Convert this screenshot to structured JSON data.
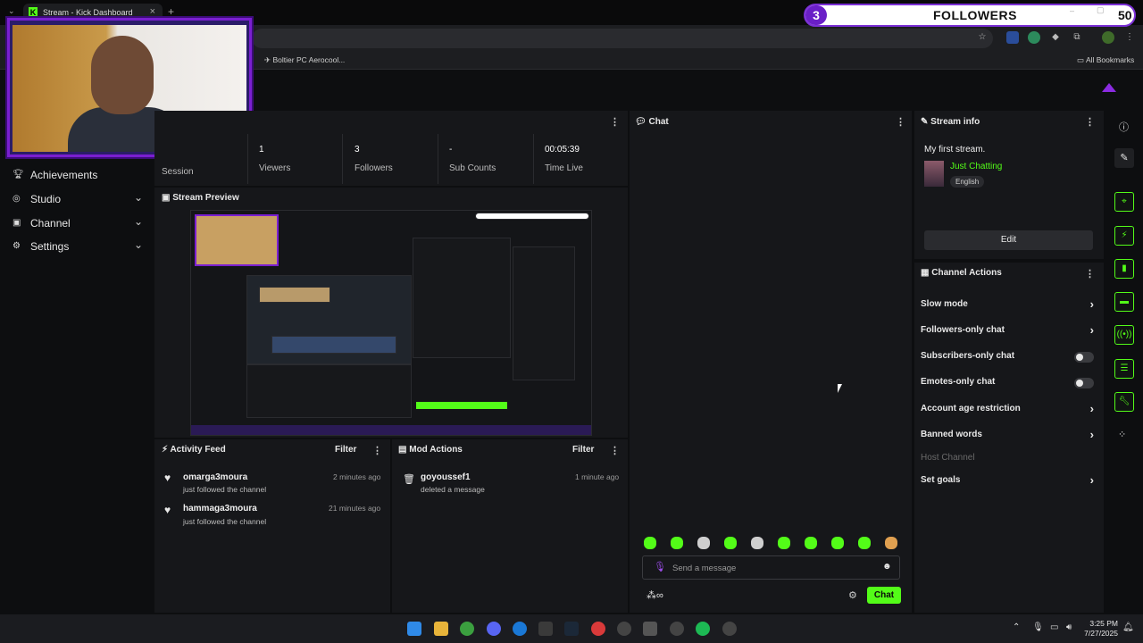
{
  "browser": {
    "tab_title": "Stream - Kick Dashboard",
    "bookmark": "Boltier PC Aerocool...",
    "all_bookmarks": "All Bookmarks"
  },
  "goal": {
    "current": "3",
    "label": "FOLLOWERS",
    "target": "50",
    "progress_fraction": 0.06,
    "accent": "#7b2fd6"
  },
  "sidebar": {
    "items": [
      {
        "label": "Achievements",
        "icon": "trophy-icon"
      },
      {
        "label": "Studio",
        "icon": "studio-icon"
      },
      {
        "label": "Channel",
        "icon": "channel-icon"
      },
      {
        "label": "Settings",
        "icon": "gear-icon"
      }
    ]
  },
  "stats": {
    "session_label": "Session",
    "items": [
      {
        "value": "1",
        "label": "Viewers"
      },
      {
        "value": "3",
        "label": "Followers"
      },
      {
        "value": "-",
        "label": "Sub Counts"
      },
      {
        "value": "00:05:39",
        "label": "Time Live"
      }
    ]
  },
  "preview": {
    "title": "Stream Preview"
  },
  "activity": {
    "title": "Activity Feed",
    "filter": "Filter",
    "items": [
      {
        "name": "omarga3moura",
        "action": "just followed the channel",
        "time": "2 minutes ago"
      },
      {
        "name": "hammaga3moura",
        "action": "just followed the channel",
        "time": "21 minutes ago"
      }
    ]
  },
  "mod_actions": {
    "title": "Mod Actions",
    "filter": "Filter",
    "items": [
      {
        "name": "goyoussef1",
        "action": "deleted a message",
        "time": "1 minute ago"
      }
    ]
  },
  "chat": {
    "title": "Chat",
    "placeholder": "Send a message",
    "send_label": "Chat",
    "accent": "#53fc18"
  },
  "stream_info": {
    "title": "Stream info",
    "stream_title": "My first stream.",
    "category": "Just Chatting",
    "language": "English",
    "edit_label": "Edit"
  },
  "channel_actions": {
    "title": "Channel Actions",
    "items": [
      {
        "label": "Slow mode",
        "control": "arrow"
      },
      {
        "label": "Followers-only chat",
        "control": "arrow"
      },
      {
        "label": "Subscribers-only chat",
        "control": "toggle"
      },
      {
        "label": "Emotes-only chat",
        "control": "toggle"
      },
      {
        "label": "Account age restriction",
        "control": "arrow"
      },
      {
        "label": "Banned words",
        "control": "arrow"
      },
      {
        "label": "Host Channel",
        "control": "disabled"
      },
      {
        "label": "Set goals",
        "control": "arrow"
      }
    ]
  },
  "taskbar": {
    "time": "3:25 PM",
    "date": "7/27/2025"
  }
}
